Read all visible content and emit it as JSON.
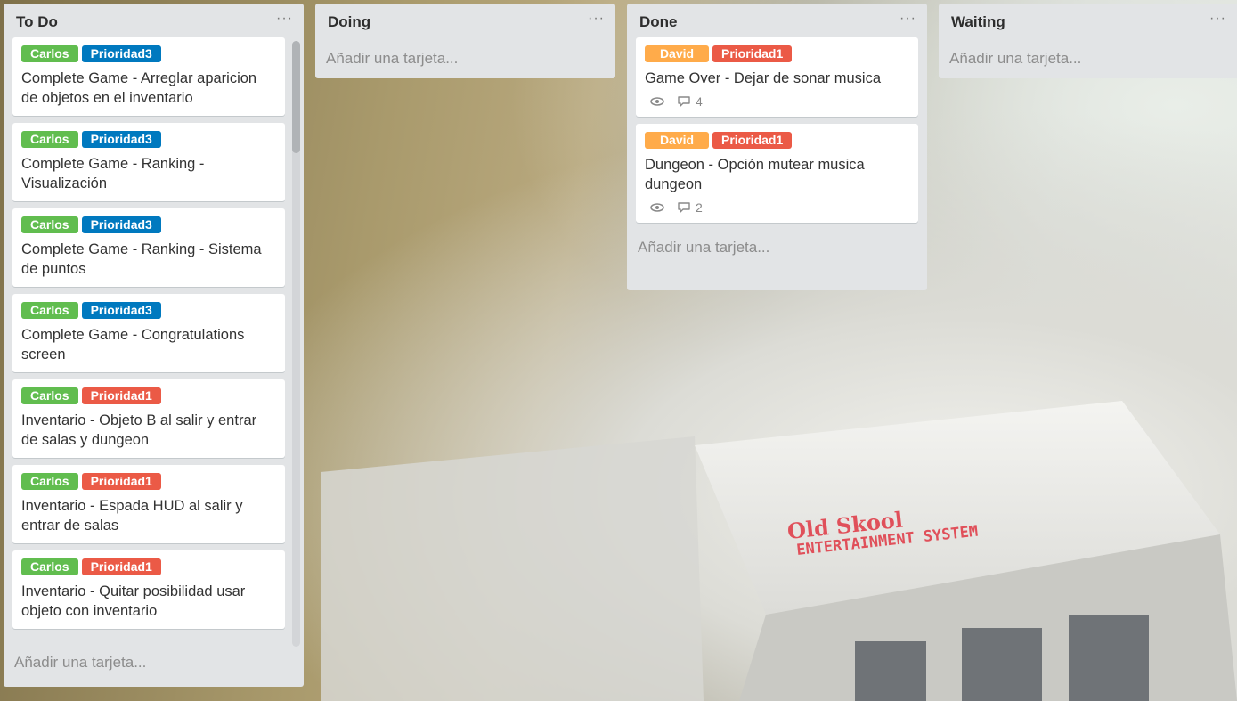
{
  "colors": {
    "green": "#61bd4f",
    "blue": "#0079bf",
    "red": "#eb5a46",
    "orange": "#ffab4a"
  },
  "lists": [
    {
      "title": "To Do",
      "menu": "···",
      "add_card": "Añadir una tarjeta...",
      "cards": [
        {
          "labels": [
            {
              "text": "Carlos",
              "color": "green"
            },
            {
              "text": "Prioridad3",
              "color": "blue"
            }
          ],
          "title": "Complete Game - Arreglar aparicion de objetos en el inventario"
        },
        {
          "labels": [
            {
              "text": "Carlos",
              "color": "green"
            },
            {
              "text": "Prioridad3",
              "color": "blue"
            }
          ],
          "title": "Complete Game - Ranking - Visualización"
        },
        {
          "labels": [
            {
              "text": "Carlos",
              "color": "green"
            },
            {
              "text": "Prioridad3",
              "color": "blue"
            }
          ],
          "title": "Complete Game - Ranking - Sistema de puntos"
        },
        {
          "labels": [
            {
              "text": "Carlos",
              "color": "green"
            },
            {
              "text": "Prioridad3",
              "color": "blue"
            }
          ],
          "title": "Complete Game - Congratulations screen"
        },
        {
          "labels": [
            {
              "text": "Carlos",
              "color": "green"
            },
            {
              "text": "Prioridad1",
              "color": "red"
            }
          ],
          "title": "Inventario - Objeto B al salir y entrar de salas y dungeon"
        },
        {
          "labels": [
            {
              "text": "Carlos",
              "color": "green"
            },
            {
              "text": "Prioridad1",
              "color": "red"
            }
          ],
          "title": "Inventario - Espada HUD al salir y entrar de salas"
        },
        {
          "labels": [
            {
              "text": "Carlos",
              "color": "green"
            },
            {
              "text": "Prioridad1",
              "color": "red"
            }
          ],
          "title": "Inventario - Quitar posibilidad usar objeto con inventario"
        }
      ]
    },
    {
      "title": "Doing",
      "menu": "···",
      "add_card": "Añadir una tarjeta...",
      "cards": []
    },
    {
      "title": "Done",
      "menu": "···",
      "add_card": "Añadir una tarjeta...",
      "cards": [
        {
          "labels": [
            {
              "text": "David",
              "color": "orange"
            },
            {
              "text": "Prioridad1",
              "color": "red"
            }
          ],
          "title": "Game Over - Dejar de sonar musica",
          "watch_icon": "eye-icon",
          "comments": "4"
        },
        {
          "labels": [
            {
              "text": "David",
              "color": "orange"
            },
            {
              "text": "Prioridad1",
              "color": "red"
            }
          ],
          "title": "Dungeon - Opción mutear musica dungeon",
          "watch_icon": "eye-icon",
          "comments": "2"
        }
      ]
    },
    {
      "title": "Waiting",
      "menu": "···",
      "add_card": "Añadir una tarjeta...",
      "cards": []
    }
  ],
  "background": {
    "logo_line1": "Old Skool",
    "logo_line2": "ENTERTAINMENT SYSTEM"
  }
}
